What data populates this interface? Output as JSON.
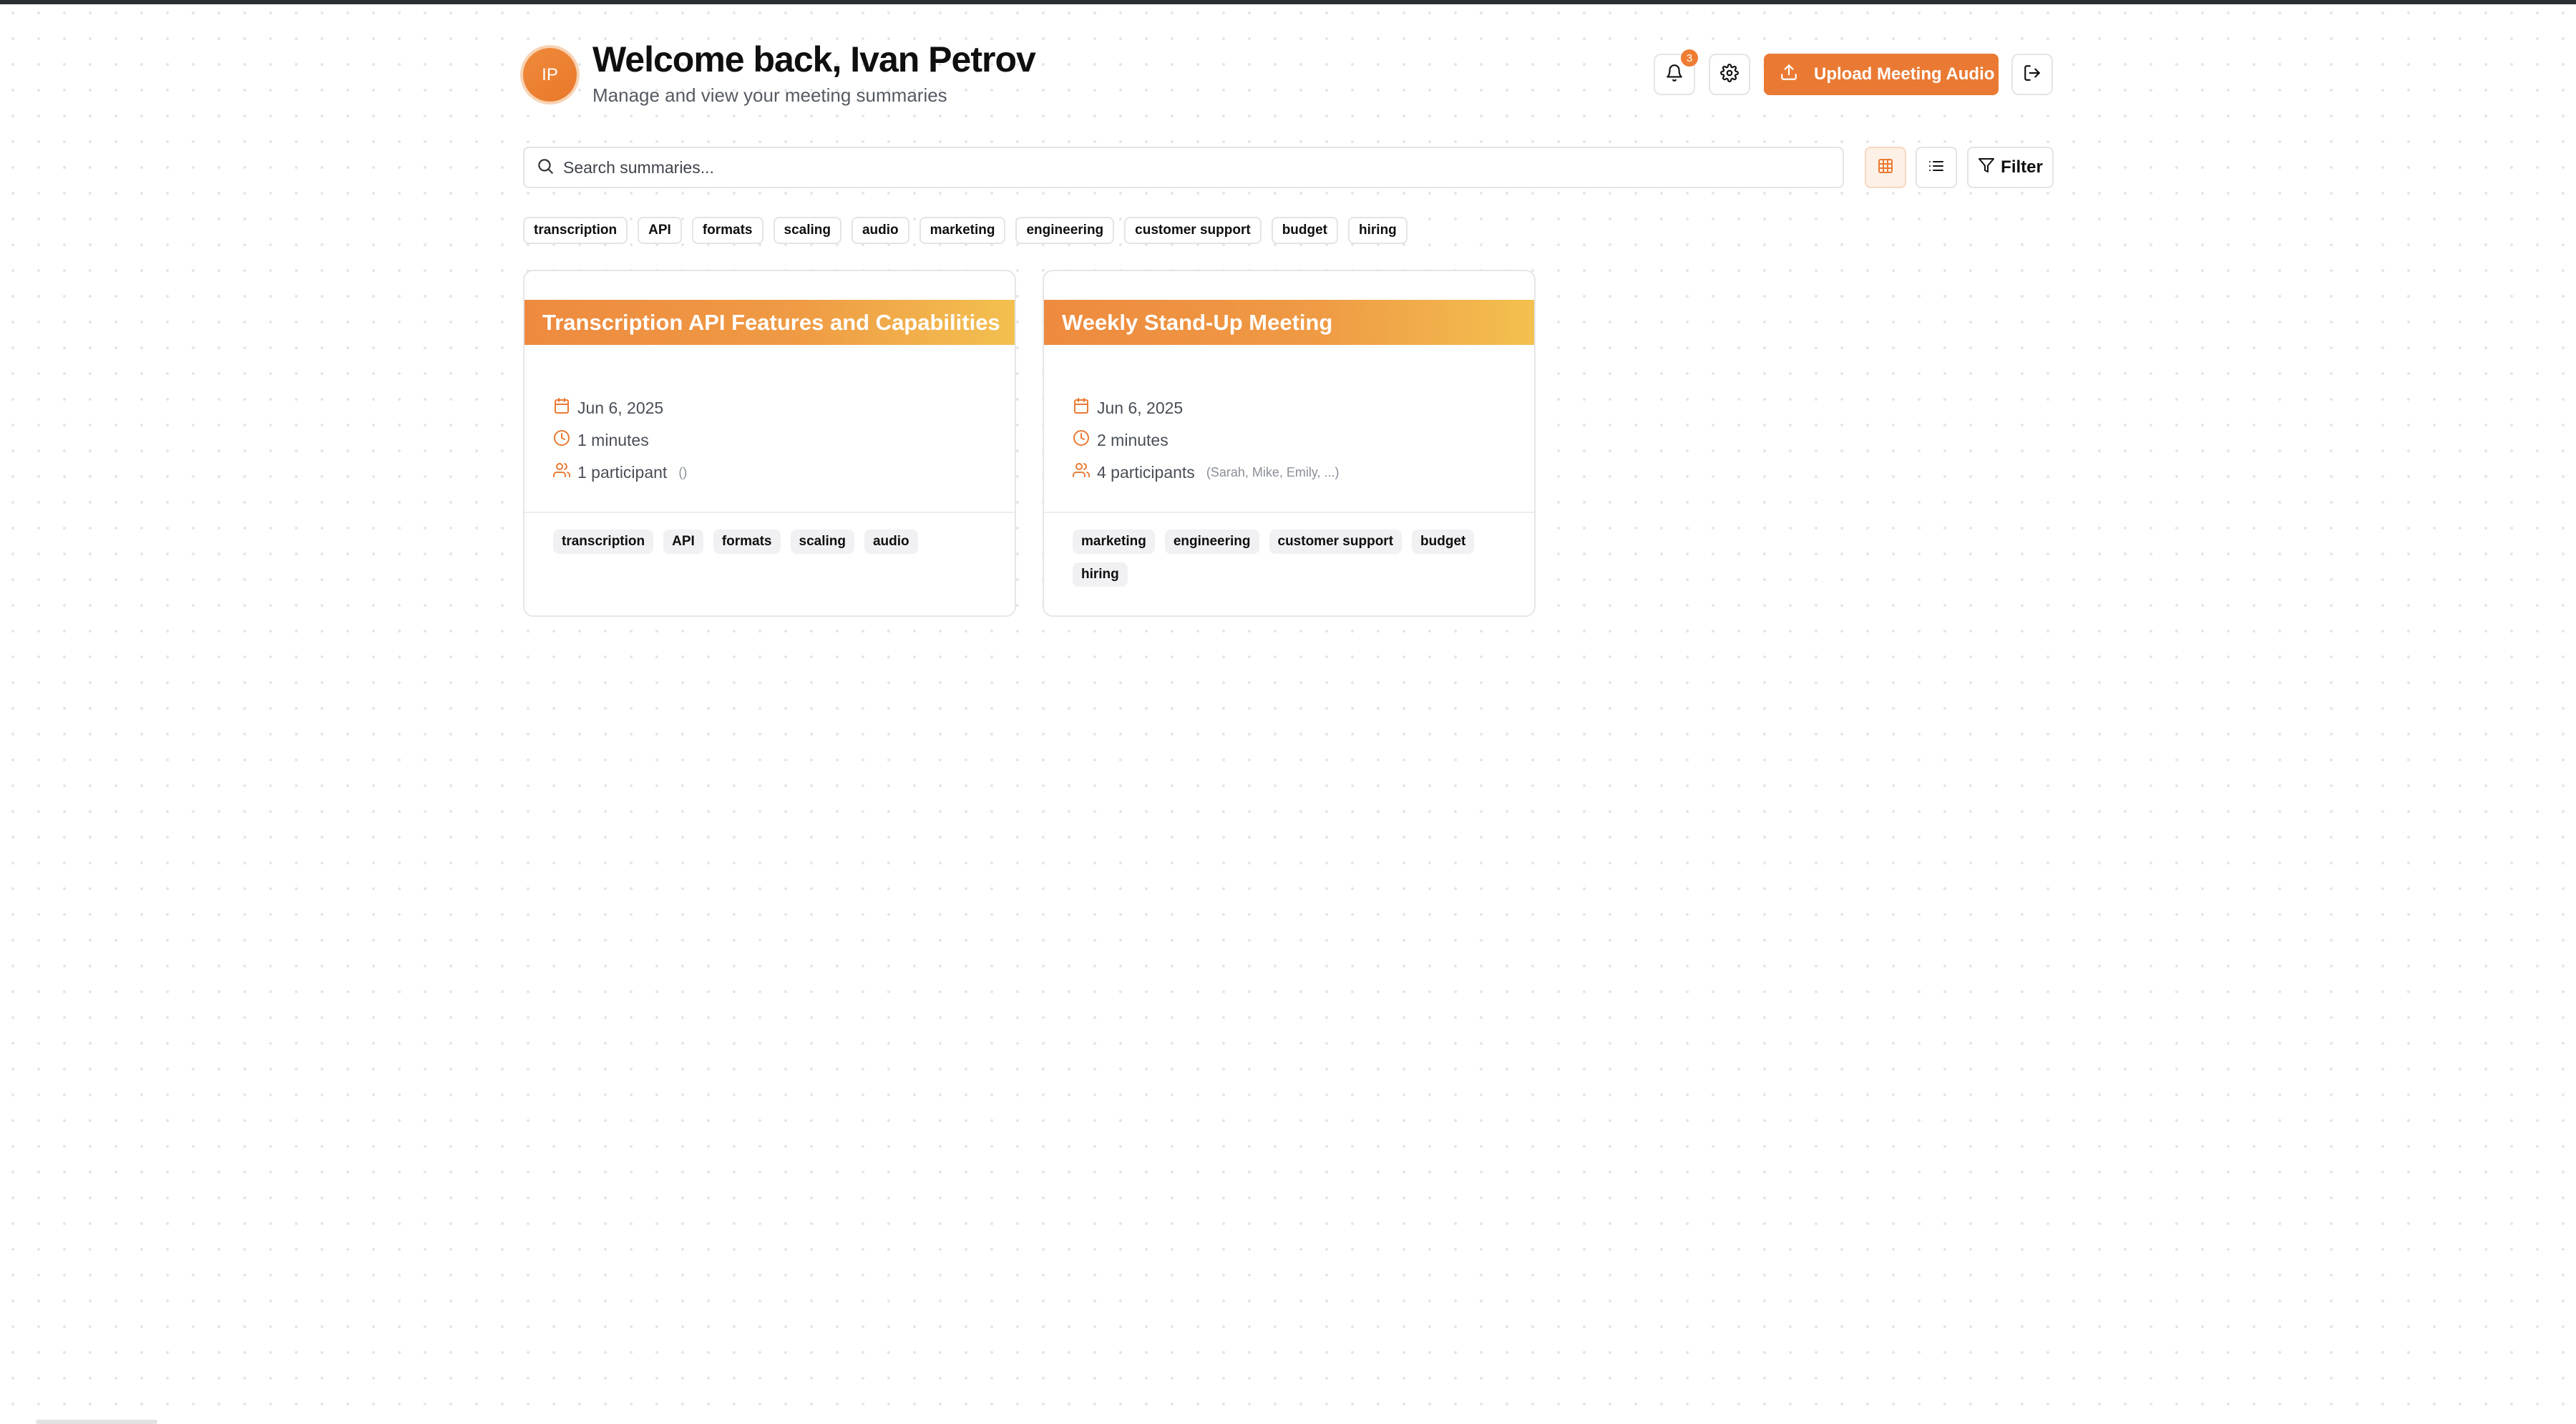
{
  "header": {
    "avatar_initials": "IP",
    "welcome": "Welcome back, Ivan Petrov",
    "subtitle": "Manage and view your meeting summaries",
    "notification_count": "3",
    "upload_label": "Upload Meeting Audio"
  },
  "search": {
    "placeholder": "Search summaries..."
  },
  "toolbar": {
    "filter_label": "Filter"
  },
  "tags": [
    "transcription",
    "API",
    "formats",
    "scaling",
    "audio",
    "marketing",
    "engineering",
    "customer support",
    "budget",
    "hiring"
  ],
  "cards": [
    {
      "title": "Transcription API Features and Capabilities",
      "date": "Jun 6, 2025",
      "duration": "1 minutes",
      "participants": "1 participant",
      "participants_names": "()",
      "tags": [
        "transcription",
        "API",
        "formats",
        "scaling",
        "audio"
      ]
    },
    {
      "title": "Weekly Stand-Up Meeting",
      "date": "Jun 6, 2025",
      "duration": "2 minutes",
      "participants": "4 participants",
      "participants_names": "(Sarah, Mike, Emily, ...)",
      "tags": [
        "marketing",
        "engineering",
        "customer support",
        "budget",
        "hiring"
      ]
    }
  ],
  "colors": {
    "accent": "#ea7a33",
    "gradient_start": "#ee8a3f",
    "gradient_end": "#f3c050"
  }
}
